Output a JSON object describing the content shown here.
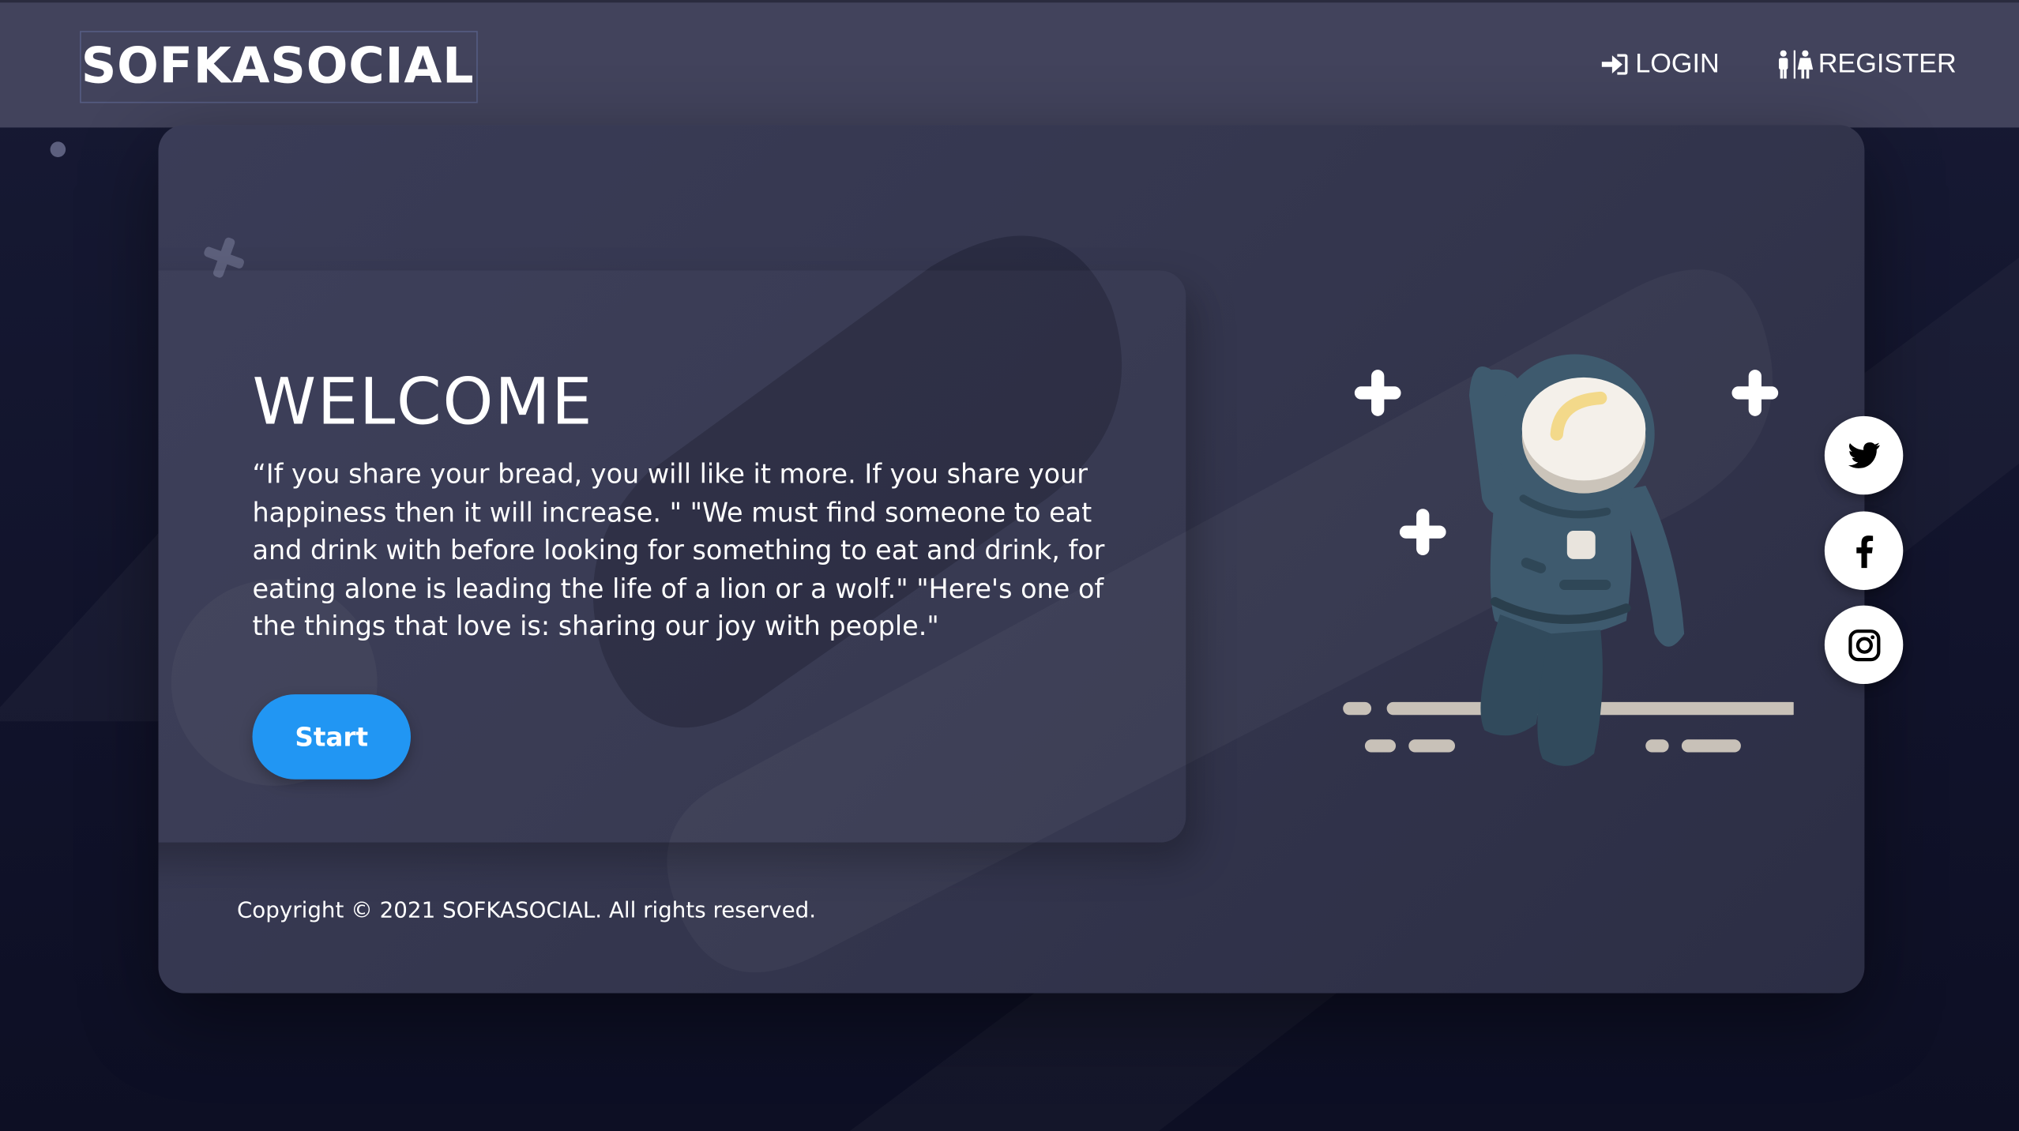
{
  "header": {
    "brand": "SOFKASOCIAL",
    "nav": {
      "login_label": "LOGIN",
      "register_label": "REGISTER"
    }
  },
  "hero": {
    "title": "WELCOME",
    "quote": "“If you share your bread, you will like it more. If you share your happiness then it will increase. \" \"We must find someone to eat and drink with before looking for something to eat and drink, for eating alone is leading the life of a lion or a wolf.\" \"Here's one of the things that love is: sharing our joy with people.\"",
    "start_label": "Start"
  },
  "footer": {
    "copyright": "Copyright © 2021 SOFKASOCIAL. All rights reserved."
  },
  "social": [
    {
      "icon": "twitter-icon"
    },
    {
      "icon": "facebook-icon"
    },
    {
      "icon": "instagram-icon"
    }
  ],
  "icons": {
    "login": "sign-in-icon",
    "register": "restroom-icon",
    "illustration": "astronaut-illustration"
  },
  "colors": {
    "header_bg": "#42435c",
    "page_bg": "#11132b",
    "card_bg": "#35374f",
    "accent_button": "#2196f3",
    "text": "#ffffff",
    "astronaut_suit": "#3e5a6e"
  }
}
